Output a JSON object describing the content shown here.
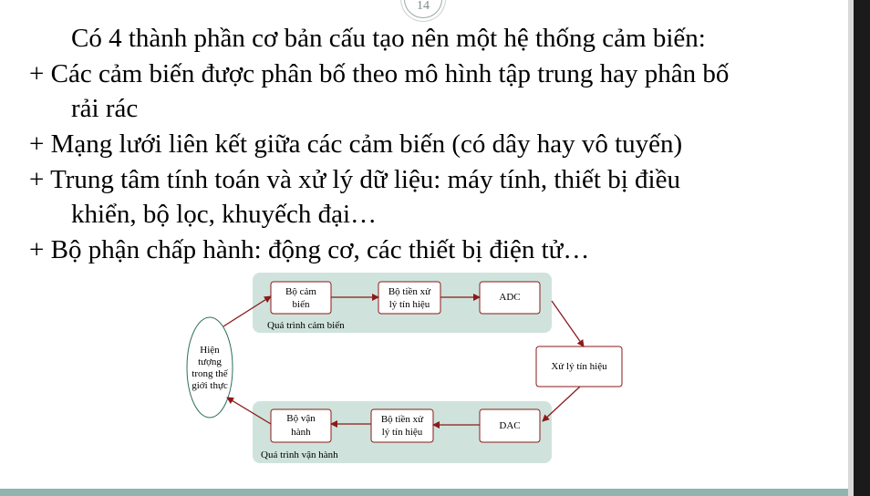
{
  "slide": {
    "page_number": "14",
    "lines": [
      "Có 4 thành phần cơ bản cấu tạo nên một hệ thống cảm biến:",
      "+ Các cảm biến được phân bố theo mô hình tập trung hay phân bố",
      "rải rác",
      "+ Mạng lưới liên kết giữa các cảm biến (có dây hay vô tuyến)",
      "+ Trung tâm tính toán và xử lý dữ liệu: máy tính, thiết bị điều",
      "khiển, bộ lọc, khuyếch đại…",
      "+ Bộ phận chấp hành: động cơ, các thiết bị điện tử…"
    ]
  },
  "diagram": {
    "real_world": [
      "Hiện",
      "tượng",
      "trong thế",
      "giới thực"
    ],
    "sensor": [
      "Bộ cảm",
      "biến"
    ],
    "pre_process_top": [
      "Bộ tiền xử",
      "lý tín hiệu"
    ],
    "adc": "ADC",
    "signal_processing": "Xử lý tín hiệu",
    "dac": "DAC",
    "pre_process_bottom": [
      "Bộ tiền xử",
      "lý tín hiệu"
    ],
    "actuator": [
      "Bộ vận",
      "hành"
    ],
    "sensing_process": "Quá trình cảm biến",
    "actuation_process": "Quá trình vận hành",
    "colors": {
      "group_fill": "#cfe3dc",
      "box_border": "#8b1a1a",
      "arrow": "#8b1a1a",
      "bottom_bar": "#8fb5ae"
    }
  }
}
